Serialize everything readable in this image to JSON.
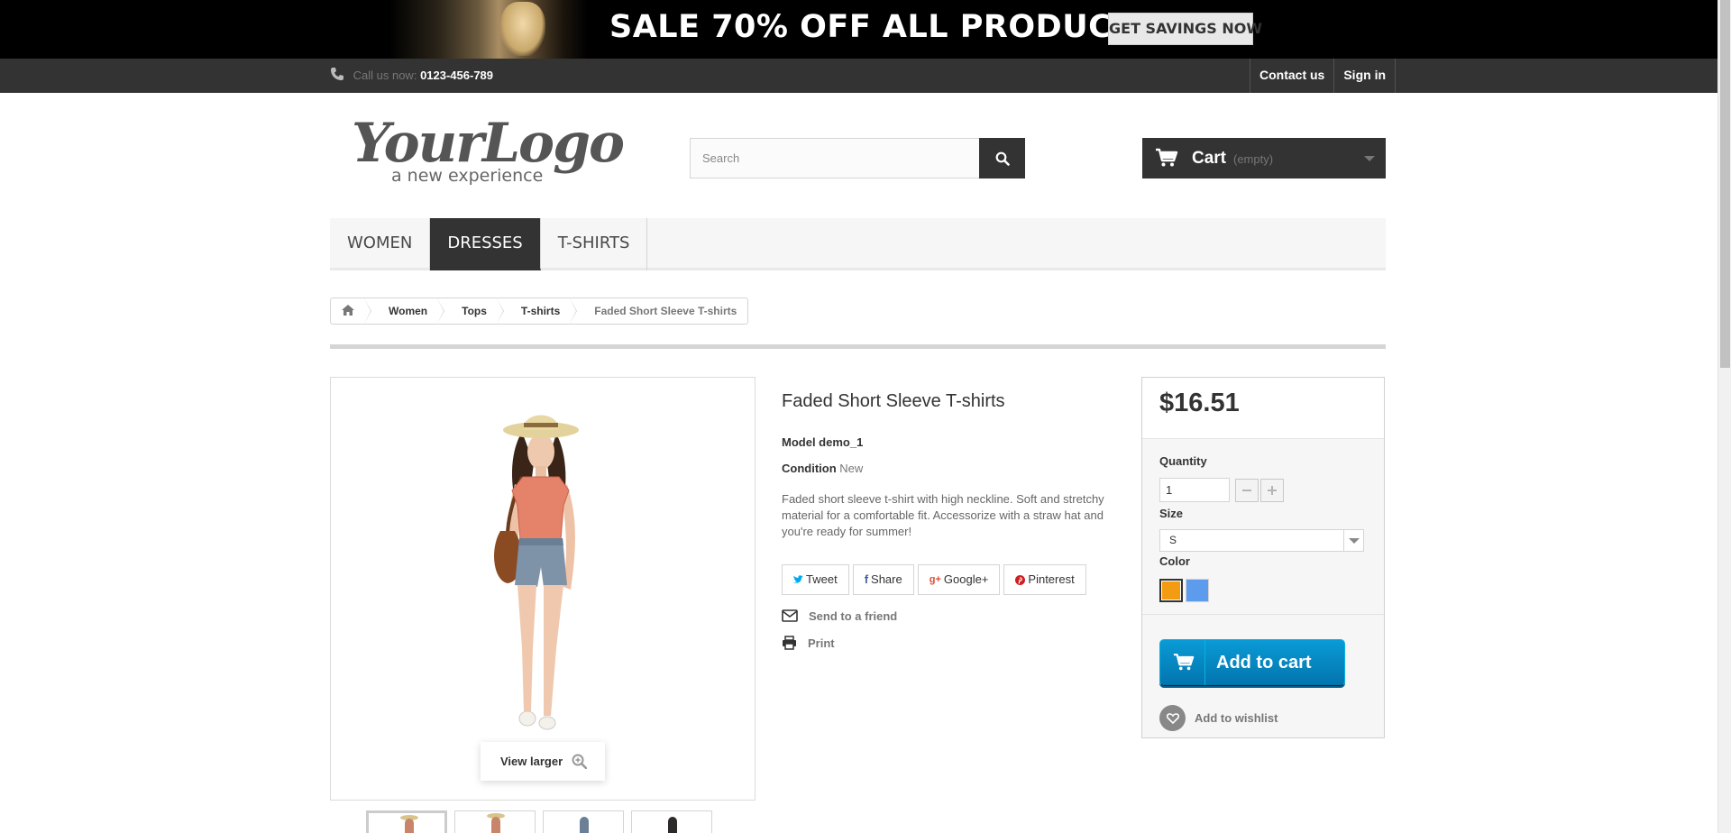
{
  "banner": {
    "headline": "SALE 70% OFF ALL PRODUCTS",
    "cta_label": "GET SAVINGS NOW"
  },
  "topbar": {
    "call_label": "Call us now:",
    "phone": "0123-456-789",
    "contact_label": "Contact us",
    "signin_label": "Sign in"
  },
  "header": {
    "logo_main": "YourLogo",
    "logo_tagline": "a new experience",
    "search_placeholder": "Search",
    "cart_label": "Cart",
    "cart_status": "(empty)"
  },
  "menu": {
    "items": [
      {
        "label": "WOMEN",
        "active": false
      },
      {
        "label": "DRESSES",
        "active": true
      },
      {
        "label": "T-SHIRTS",
        "active": false
      }
    ]
  },
  "breadcrumb": {
    "items": [
      "Women",
      "Tops",
      "T-shirts"
    ],
    "current": "Faded Short Sleeve T-shirts"
  },
  "product": {
    "view_larger_label": "View larger",
    "title": "Faded Short Sleeve T-shirts",
    "model_label": "Model demo_1",
    "condition_label": "Condition",
    "condition_value": "New",
    "description": "Faded short sleeve t-shirt with high neckline. Soft and stretchy material for a comfortable fit. Accessorize with a straw hat and you're ready for summer!",
    "share": {
      "tweet": "Tweet",
      "share": "Share",
      "google": "Google+",
      "pinterest": "Pinterest"
    },
    "send_friend_label": "Send to a friend",
    "print_label": "Print"
  },
  "buybox": {
    "price": "$16.51",
    "quantity_label": "Quantity",
    "quantity_value": "1",
    "size_label": "Size",
    "size_value": "S",
    "color_label": "Color",
    "colors": [
      "#f39c11",
      "#5d9cec"
    ],
    "add_to_cart_label": "Add to cart",
    "wishlist_label": "Add to wishlist"
  },
  "colors": {
    "dark": "#333333",
    "accent_blue": "#0274ad"
  }
}
